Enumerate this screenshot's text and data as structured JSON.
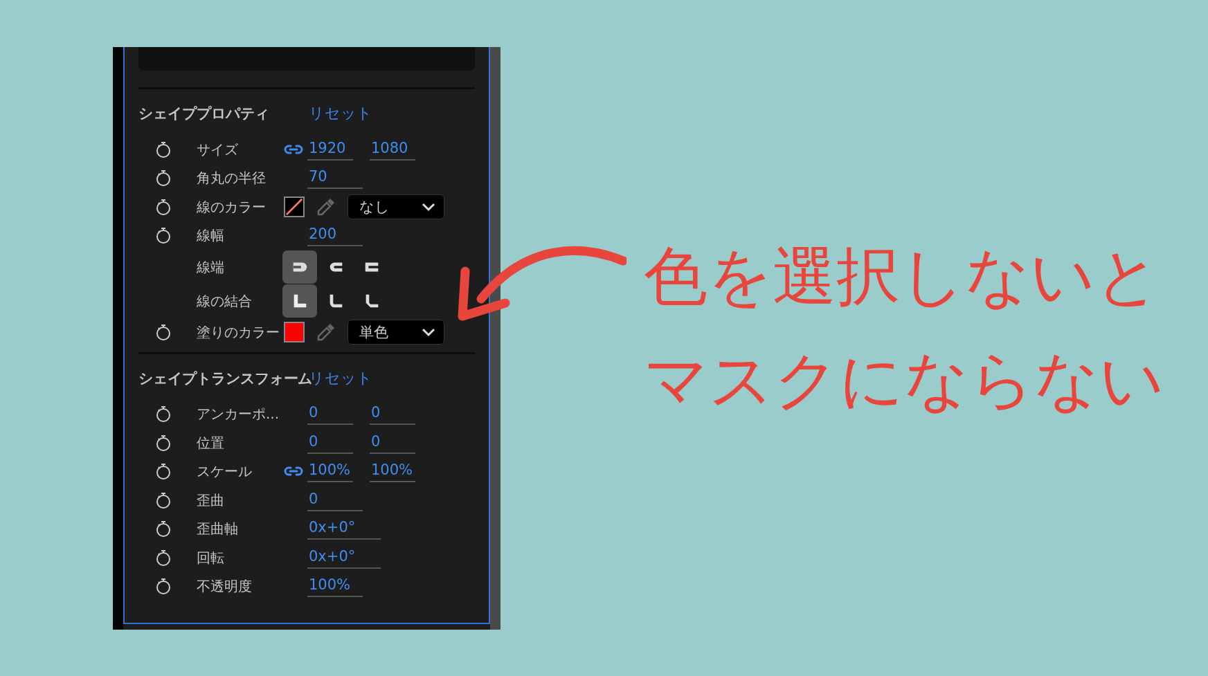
{
  "panel": {
    "sections": [
      {
        "title": "シェイププロパティ",
        "reset": "リセット",
        "rows": [
          {
            "kind": "pair",
            "animatable": true,
            "label": "サイズ",
            "linked": true,
            "values": [
              "1920",
              "1080"
            ]
          },
          {
            "kind": "single",
            "animatable": true,
            "label": "角丸の半径",
            "values": [
              "70"
            ]
          },
          {
            "kind": "color",
            "animatable": true,
            "label": "線のカラー",
            "swatch": {
              "kind": "none"
            },
            "fill_type": "なし"
          },
          {
            "kind": "single",
            "animatable": true,
            "label": "線幅",
            "values": [
              "200"
            ]
          },
          {
            "kind": "buttons",
            "animatable": false,
            "label": "線端",
            "options": [
              {
                "kind": "butt",
                "selected": true
              },
              {
                "kind": "round",
                "selected": false
              },
              {
                "kind": "square",
                "selected": false
              }
            ]
          },
          {
            "kind": "buttons",
            "animatable": false,
            "label": "線の結合",
            "options": [
              {
                "kind": "miter",
                "selected": true
              },
              {
                "kind": "round-join",
                "selected": false
              },
              {
                "kind": "bevel",
                "selected": false
              }
            ]
          },
          {
            "kind": "color",
            "animatable": true,
            "label": "塗りのカラー",
            "swatch": {
              "kind": "solid",
              "color": "#ff0000"
            },
            "fill_type": "単色"
          }
        ]
      },
      {
        "title": "シェイプトランスフォーム",
        "reset": "リセット",
        "rows": [
          {
            "kind": "pair",
            "animatable": true,
            "label": "アンカーポ...",
            "linked": false,
            "values": [
              "0",
              "0"
            ]
          },
          {
            "kind": "pair",
            "animatable": true,
            "label": "位置",
            "linked": false,
            "values": [
              "0",
              "0"
            ]
          },
          {
            "kind": "pair",
            "animatable": true,
            "label": "スケール",
            "linked": true,
            "values": [
              "100%",
              "100%"
            ]
          },
          {
            "kind": "single",
            "animatable": true,
            "label": "歪曲",
            "values": [
              "0"
            ]
          },
          {
            "kind": "angle",
            "animatable": true,
            "label": "歪曲軸",
            "values": [
              "0x+0°"
            ]
          },
          {
            "kind": "angle",
            "animatable": true,
            "label": "回転",
            "values": [
              "0x+0°"
            ]
          },
          {
            "kind": "single",
            "animatable": true,
            "label": "不透明度",
            "values": [
              "100%"
            ]
          }
        ]
      }
    ]
  },
  "annotation": {
    "lines": [
      "色を選択しないと",
      "マスクにならない"
    ]
  }
}
